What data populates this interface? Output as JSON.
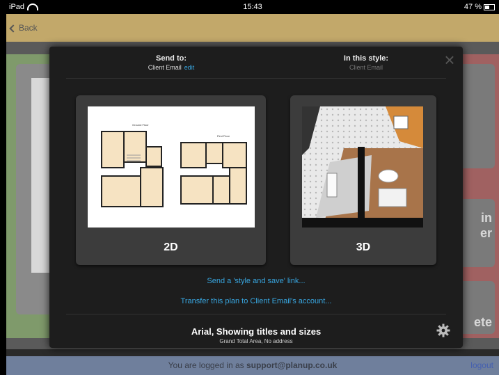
{
  "status_bar": {
    "device": "iPad",
    "time": "15:43",
    "battery": "47 %"
  },
  "nav": {
    "back_label": "Back"
  },
  "background": {
    "right_text_1": "in",
    "right_text_2": "er",
    "right_text_3": "ete"
  },
  "modal": {
    "send_to_title": "Send to:",
    "send_to_value": "Client Email",
    "edit_label": "edit",
    "style_title": "In this style:",
    "style_value": "Client Email",
    "close_icon": "close-icon",
    "options": [
      {
        "label": "2D"
      },
      {
        "label": "3D"
      }
    ],
    "plan_2d": {
      "ground_floor_title": "Ground Floor",
      "first_floor_title": "First Floor"
    },
    "link_style_save": "Send a 'style and save' link...",
    "link_transfer": "Transfer this plan to Client Email's account...",
    "format_title": "Arial, Showing titles and sizes",
    "format_sub": "Grand Total Area, No address",
    "settings_icon": "gear-icon"
  },
  "footer": {
    "logged_in_prefix": "You are logged in as ",
    "user_email": "support@planup.co.uk",
    "logout_label": "logout"
  },
  "colors": {
    "link": "#38a6e0",
    "nav_bar": "#c2a86a",
    "footer": "#6f7f9c",
    "modal_bg": "#1d1d1d"
  }
}
